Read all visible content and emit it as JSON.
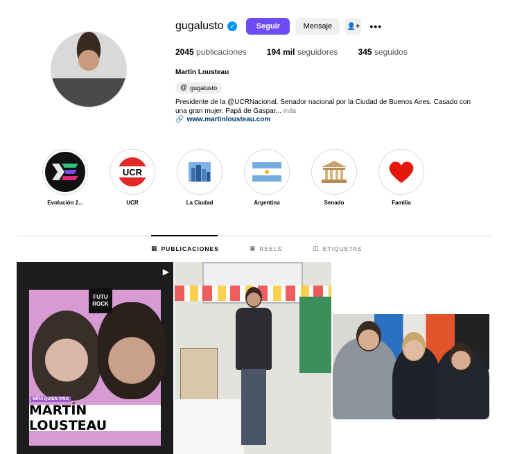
{
  "profile": {
    "username": "gugalusto",
    "verified": true,
    "follow_label": "Seguir",
    "message_label": "Mensaje",
    "add_friend_icon": "user-plus-icon",
    "more_icon": "•••",
    "stats": {
      "posts_count": "2045",
      "posts_label": "publicaciones",
      "followers_count": "194 mil",
      "followers_label": "seguidores",
      "following_count": "345",
      "following_label": "seguidos"
    },
    "full_name": "Martín Lousteau",
    "threads_handle": "gugalusto",
    "bio_line1": "Presidente de la @UCRNacional. Senador nacional por la Ciudad de Buenos Aires. Casado con",
    "bio_line2": "una gran mujer. Papá de Gaspar...",
    "bio_more": "más",
    "website": "www.martinlousteau.com"
  },
  "highlights": [
    {
      "label": "Evolución 2...",
      "icon": "evolucion-logo"
    },
    {
      "label": "UCR",
      "icon": "ucr-logo"
    },
    {
      "label": "La Ciudad",
      "icon": "city-emoji"
    },
    {
      "label": "Argentina",
      "icon": "argentina-flag"
    },
    {
      "label": "Senado",
      "icon": "classical-building-emoji"
    },
    {
      "label": "Familia",
      "icon": "red-heart-emoji"
    }
  ],
  "tabs": [
    {
      "label": "PUBLICACIONES",
      "icon": "grid-icon",
      "active": true
    },
    {
      "label": "REELS",
      "icon": "reels-icon",
      "active": false
    },
    {
      "label": "ETIQUETAS",
      "icon": "tag-icon",
      "active": false
    }
  ],
  "posts": {
    "post1": {
      "brand": "FUTU ROCK",
      "kicker": "MIRA QUIEN VINO",
      "headline": "MARTÍN LOUSTEAU"
    }
  },
  "colors": {
    "follow_button": "#6b4cf6",
    "verified_badge": "#0095f6",
    "link": "#00376b"
  }
}
